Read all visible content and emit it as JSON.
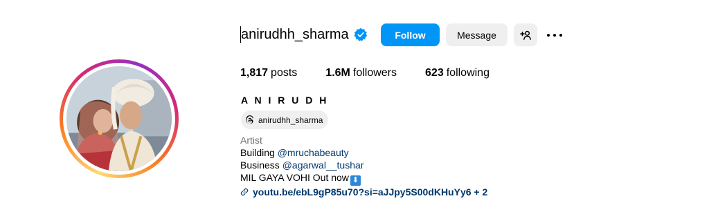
{
  "profile": {
    "username": "anirudhh_sharma",
    "verified": true,
    "full_name": "A N I R U D H",
    "threads_handle": "anirudhh_sharma",
    "avatar_icon": "profile-photo"
  },
  "actions": {
    "follow_label": "Follow",
    "message_label": "Message",
    "suggest_icon": "add-person-icon",
    "more_icon": "more-options-icon"
  },
  "stats": {
    "posts_count": "1,817",
    "posts_label": "posts",
    "followers_count": "1.6M",
    "followers_label": "followers",
    "following_count": "623",
    "following_label": "following"
  },
  "bio": {
    "category": "Artist",
    "line1_text": "Building ",
    "line1_mention": "@mruchabeauty",
    "line2_text": "Business ",
    "line2_mention": "@agarwal__tushar",
    "line3_text": "MIL GAYA VOHI Out now",
    "line3_emoji": "⬇",
    "link_text": "youtu.be/ebL9gP85u70?si=aJJpy5S00dKHuYy6 + 2"
  },
  "colors": {
    "accent": "#0095f6",
    "secondary_button": "#efefef",
    "mention": "#00376b",
    "muted": "#737373"
  }
}
